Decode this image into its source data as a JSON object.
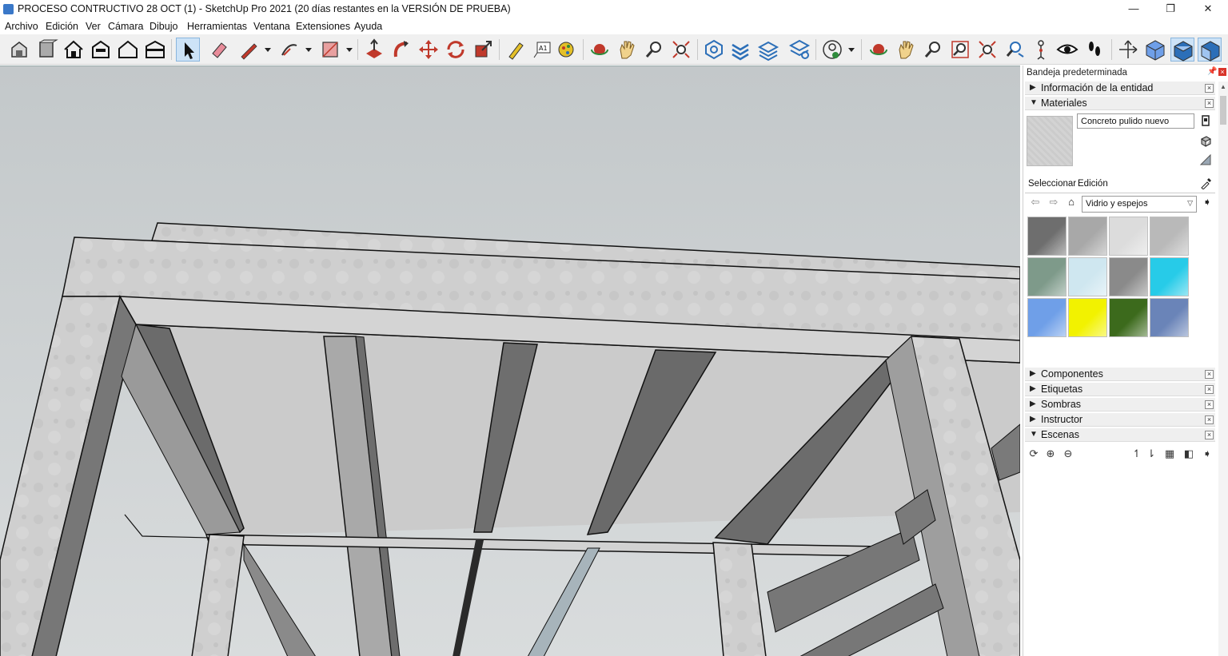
{
  "window": {
    "title": "PROCESO CONTRUCTIVO 28 OCT (1) - SketchUp Pro 2021 (20 días restantes en la VERSIÓN DE PRUEBA)",
    "minimize": "—",
    "maximize": "❐",
    "close": "✕"
  },
  "menu": {
    "items": [
      "Archivo",
      "Edición",
      "Ver",
      "Cámara",
      "Dibujo",
      "Herramientas",
      "Ventana",
      "Extensiones",
      "Ayuda"
    ]
  },
  "toolbar": {
    "tools": [
      "warehouse",
      "components",
      "home",
      "front-view",
      "house-outline",
      "back-view",
      "select",
      "eraser",
      "line",
      "line-dropdown",
      "arc",
      "arc-dropdown",
      "rectangle",
      "rectangle-dropdown",
      "push-pull",
      "follow-me",
      "move",
      "rotate",
      "scale",
      "tape-measure",
      "text",
      "paint-bucket",
      "orbit",
      "pan",
      "zoom",
      "zoom-extents",
      "model-info",
      "section-plane",
      "layers",
      "styles",
      "account",
      "account-dropdown",
      "orbit-2",
      "pan-2",
      "zoom-2",
      "zoom-window",
      "zoom-extents-2",
      "previous",
      "position-camera",
      "look-around",
      "walk",
      "axes",
      "iso-view",
      "top-view",
      "front-view-2"
    ],
    "active_tool": "select"
  },
  "tray": {
    "title": "Bandeja predeterminada",
    "panels": [
      {
        "label": "Información de la entidad",
        "expanded": false
      },
      {
        "label": "Materiales",
        "expanded": true
      },
      {
        "label": "Componentes",
        "expanded": false
      },
      {
        "label": "Etiquetas",
        "expanded": false
      },
      {
        "label": "Sombras",
        "expanded": false
      },
      {
        "label": "Instructor",
        "expanded": false
      },
      {
        "label": "Escenas",
        "expanded": true
      }
    ],
    "materials": {
      "current_name": "Concreto pulido nuevo",
      "tabs": [
        "Seleccionar",
        "Edición"
      ],
      "active_tab": "Seleccionar",
      "library": "Vidrio y espejos",
      "swatch_colors": [
        "#6e6e6e",
        "#a8a8a8",
        "#dcdcdc",
        "#b9b9b9",
        "#7e9a8a",
        "#cfe7f0",
        "#8a8a8a",
        "#27cbe8",
        "#6f9fe8",
        "#f2f200",
        "#3c6a1c",
        "#6a84b8"
      ]
    }
  }
}
